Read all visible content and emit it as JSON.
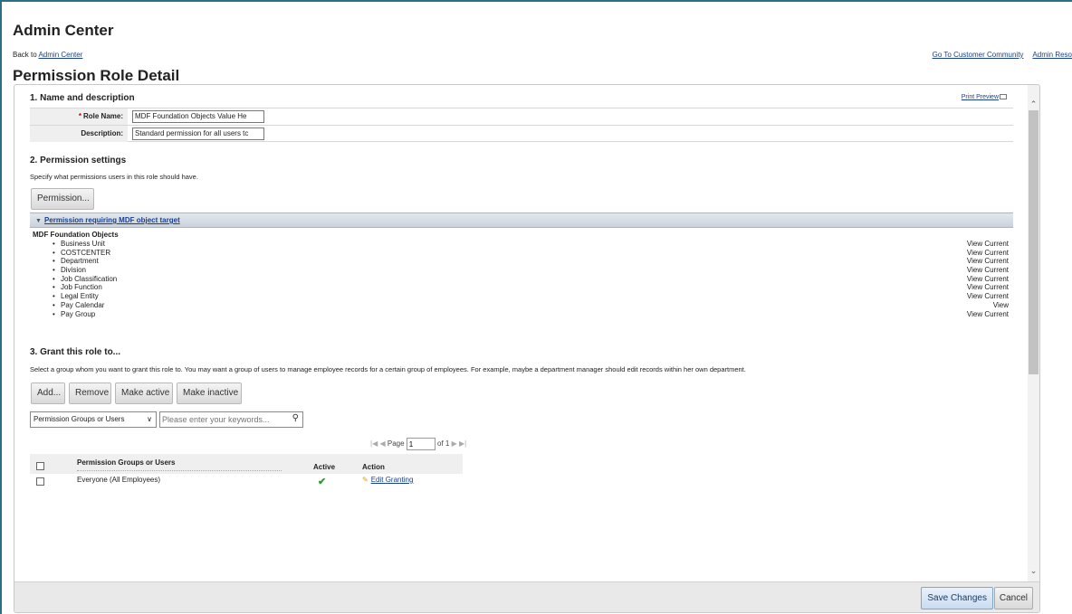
{
  "app": {
    "title": "Admin Center"
  },
  "nav": {
    "back_prefix": "Back to ",
    "back_link": "Admin Center",
    "links": [
      "Go To Customer Community",
      "Admin Reso"
    ]
  },
  "page": {
    "title": "Permission Role Detail"
  },
  "section1": {
    "heading": "1. Name and description",
    "print_preview": "Print Preview",
    "role_name_label": "Role Name:",
    "role_name_required": "*",
    "role_name_value": "MDF Foundation Objects Value He",
    "description_label": "Description:",
    "description_value": "Standard permission for all users tc"
  },
  "section2": {
    "heading": "2. Permission settings",
    "help": "Specify what permissions users in this role should have.",
    "permission_button": "Permission...",
    "collapse_title": "Permission requiring MDF object target",
    "group_heading": "MDF Foundation Objects",
    "permissions": [
      {
        "name": "Business Unit",
        "access": "View Current"
      },
      {
        "name": "COSTCENTER",
        "access": "View Current"
      },
      {
        "name": "Department",
        "access": "View Current"
      },
      {
        "name": "Division",
        "access": "View Current"
      },
      {
        "name": "Job Classification",
        "access": "View Current"
      },
      {
        "name": "Job Function",
        "access": "View Current"
      },
      {
        "name": "Legal Entity",
        "access": "View Current"
      },
      {
        "name": "Pay Calendar",
        "access": "View"
      },
      {
        "name": "Pay Group",
        "access": "View Current"
      }
    ]
  },
  "section3": {
    "heading": "3. Grant this role to...",
    "help": "Select a group whom you want to grant this role to. You may want a group of users to manage employee records for a certain group of employees. For example, maybe a department manager should edit records within her own department.",
    "buttons": {
      "add": "Add...",
      "remove": "Remove",
      "make_active": "Make active",
      "make_inactive": "Make inactive"
    },
    "filter_select": "Permission Groups or Users",
    "search_placeholder": "Please enter your keywords...",
    "pager": {
      "page_label": "Page",
      "page_value": "1",
      "of_label": "of 1"
    },
    "table": {
      "headers": {
        "name": "Permission Groups or Users",
        "active": "Active",
        "action": "Action"
      },
      "rows": [
        {
          "name": "Everyone (All Employees)",
          "active": "✔",
          "action": "Edit Granting"
        }
      ]
    }
  },
  "footer": {
    "save": "Save Changes",
    "cancel": "Cancel"
  },
  "colors": {
    "link": "#1a3f8f",
    "frame": "#2a6f83",
    "active_check": "#2e9a2e"
  }
}
